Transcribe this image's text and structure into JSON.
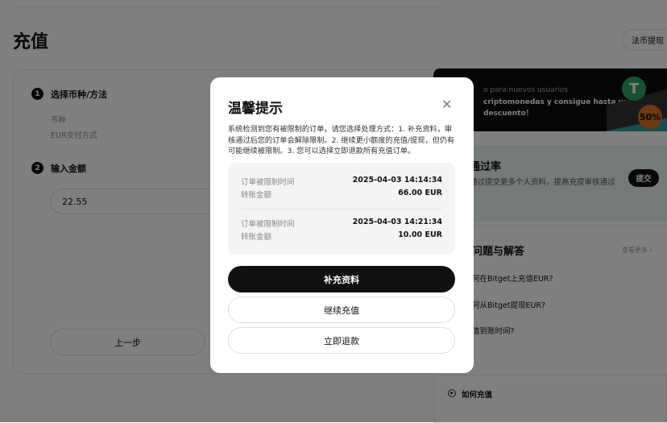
{
  "page": {
    "title": "充值",
    "withdraw_button": "法币提现"
  },
  "steps": [
    {
      "num": "1",
      "label": "选择币种/方法",
      "fields": [
        "币种",
        "EUR支付方式"
      ]
    },
    {
      "num": "2",
      "label": "输入金额",
      "amount": "22.55"
    }
  ],
  "prev_button": "上一步",
  "banner": {
    "line1": "o para nuevos usuarios",
    "line2": "criptomonedas y consigue hasta un",
    "line3": "descuento！",
    "tether": "T",
    "discount": "50%"
  },
  "pass_rate": {
    "title": "通过率",
    "desc": "通过提交更多个人资料，提高充提审核通过",
    "button": "提交"
  },
  "faq": {
    "title": "问题与解答",
    "more": "查看更多",
    "items": [
      "何在Bitget上充值EUR?",
      "何从Bitget提现EUR?",
      "值到账时间?"
    ]
  },
  "howto": "如何充值",
  "modal": {
    "title": "温馨提示",
    "description": "系统检测到您有被限制的订单，请您选择处理方式：1. 补充资料，审核通过后您的订单会解除限制。2. 继续更小额度的充值/提现，但仍有可能继续被限制。3. 您可以选择立即退款所有充值订单。",
    "orders": [
      {
        "time_label": "订单被限制时间",
        "time": "2025-04-03 14:14:34",
        "amount_label": "转账金额",
        "amount": "66.00 EUR"
      },
      {
        "time_label": "订单被限制时间",
        "time": "2025-04-03 14:21:34",
        "amount_label": "转账金额",
        "amount": "10.00 EUR"
      }
    ],
    "buttons": {
      "supplement": "补充资料",
      "continue": "继续充值",
      "refund": "立即退款"
    }
  }
}
